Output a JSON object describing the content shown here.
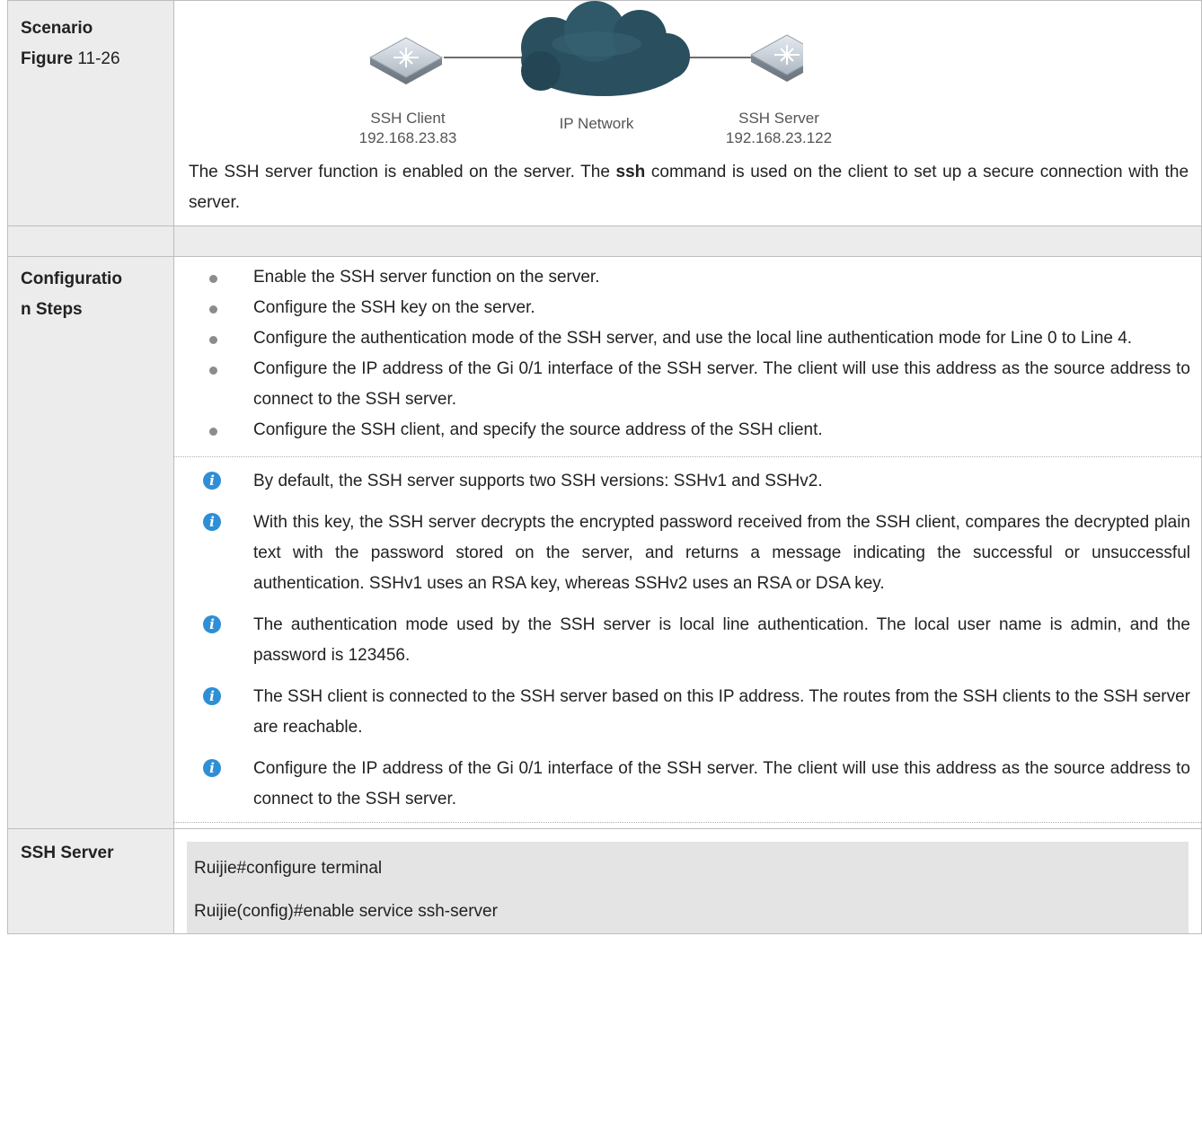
{
  "scenario": {
    "label_line1": "Scenario",
    "label_figure_bold": "Figure",
    "label_figure_num": " 11-26",
    "diagram": {
      "client_name": "SSH Client",
      "client_ip": "192.168.23.83",
      "network_name": "IP Network",
      "server_name": "SSH Server",
      "server_ip": "192.168.23.122"
    },
    "desc_before": "The SSH server function is enabled on the server. The ",
    "desc_bold": "ssh",
    "desc_after": " command is used on the client to set up a secure connection with the server."
  },
  "config_steps": {
    "label_line1": "Configuratio",
    "label_line2": "n Steps",
    "steps": [
      "Enable the SSH server function on the server.",
      "Configure the SSH key on the server.",
      "Configure the authentication mode of the SSH server, and use the local line authentication mode for Line 0 to Line 4.",
      "Configure the IP address of the Gi 0/1 interface of the SSH server. The client will use this address as the source address to connect to the SSH server.",
      "Configure the SSH client, and specify the source address of the SSH client."
    ],
    "notes": [
      "By default, the SSH server supports two SSH versions: SSHv1 and SSHv2.",
      "With this key, the SSH server decrypts the encrypted password received from the SSH client, compares the decrypted plain text with the password stored on the server, and returns a message indicating the successful or unsuccessful authentication. SSHv1 uses an RSA key, whereas SSHv2 uses an RSA or DSA key.",
      "The authentication mode used by the SSH server is local line authentication. The local user name is admin, and the password is 123456.",
      "The SSH client is connected to the SSH server based on this IP address. The routes from the SSH clients to the SSH server are reachable.",
      "Configure the IP address of the Gi 0/1 interface of the SSH server. The client will use this address as the source address to connect to the SSH server."
    ]
  },
  "ssh_server": {
    "label": "SSH Server",
    "code_lines": [
      "Ruijie#configure terminal",
      "Ruijie(config)#enable service ssh-server"
    ]
  }
}
